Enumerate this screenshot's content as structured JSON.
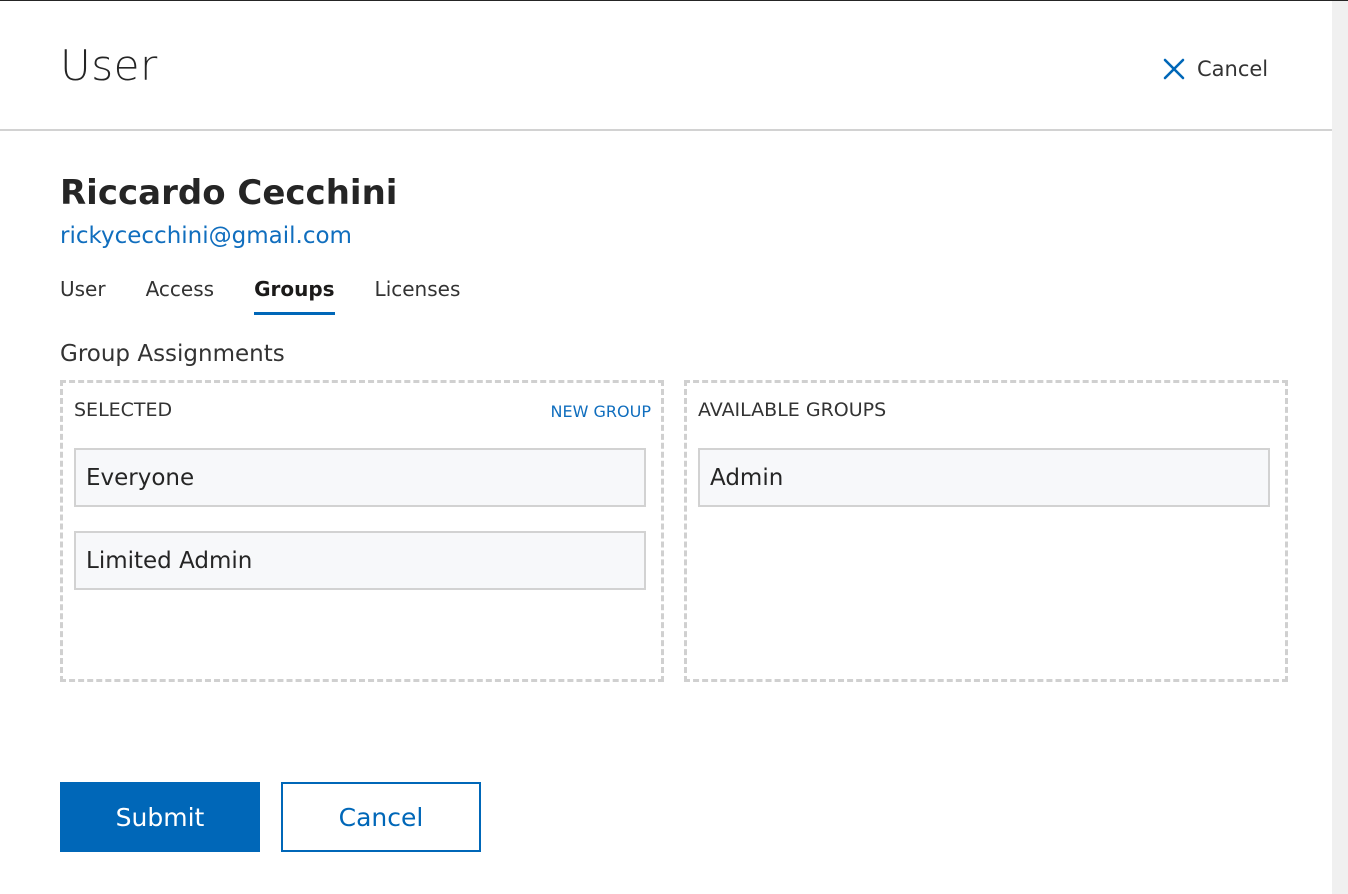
{
  "header": {
    "title": "User",
    "cancel_label": "Cancel"
  },
  "user": {
    "name": "Riccardo Cecchini",
    "email": "rickycecchini@gmail.com"
  },
  "tabs": [
    {
      "label": "User",
      "active": false
    },
    {
      "label": "Access",
      "active": false
    },
    {
      "label": "Groups",
      "active": true
    },
    {
      "label": "Licenses",
      "active": false
    }
  ],
  "group_assignments": {
    "title": "Group Assignments",
    "selected": {
      "heading": "SELECTED",
      "new_group_label": "NEW GROUP",
      "items": [
        "Everyone",
        "Limited Admin"
      ]
    },
    "available": {
      "heading": "AVAILABLE GROUPS",
      "items": [
        "Admin"
      ]
    }
  },
  "footer": {
    "submit_label": "Submit",
    "cancel_label": "Cancel"
  },
  "colors": {
    "accent": "#0067b8",
    "link": "#106ebe",
    "item_bg": "#f7f8fa",
    "border": "#d2d2d2"
  }
}
